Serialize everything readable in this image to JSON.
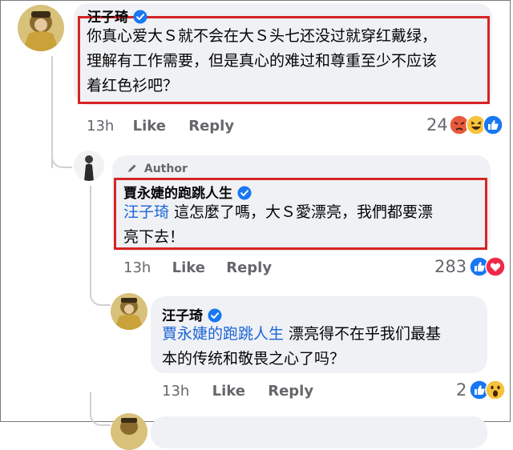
{
  "comments": [
    {
      "name": "汪子琦",
      "lines": [
        "你真心爱大Ｓ就不会在大Ｓ头七还没过就穿红戴绿，",
        "理解有工作需要，但是真心的难过和尊重至少不应该",
        "着红色衫吧？"
      ],
      "time": "13h",
      "like": "Like",
      "reply": "Reply",
      "reaction_count": "24",
      "reaction_icons": [
        "angry-icon",
        "haha-icon",
        "like-icon"
      ]
    },
    {
      "badge": "Author",
      "name": "賈永婕的跑跳人生",
      "mention": "汪子琦",
      "line1_rest": " 這怎麼了嗎，大Ｓ愛漂亮，我們都要漂",
      "line2": "亮下去！",
      "time": "13h",
      "like": "Like",
      "reply": "Reply",
      "reaction_count": "283",
      "reaction_icons": [
        "like-icon",
        "love-icon"
      ]
    },
    {
      "name": "汪子琦",
      "mention": "賈永婕的跑跳人生",
      "line1_rest": " 漂亮得不在乎我们最基",
      "line2": "本的传统和敬畏之心了吗？",
      "time": "13h",
      "like": "Like",
      "reply": "Reply",
      "reaction_count": "2",
      "reaction_icons": [
        "like-icon",
        "wow-icon"
      ]
    }
  ],
  "colors": {
    "highlight_border": "#d62424",
    "bubble": "#eff1f4",
    "mention": "#1b64d8",
    "meta": "#65676b",
    "verified": "#1877f2"
  }
}
